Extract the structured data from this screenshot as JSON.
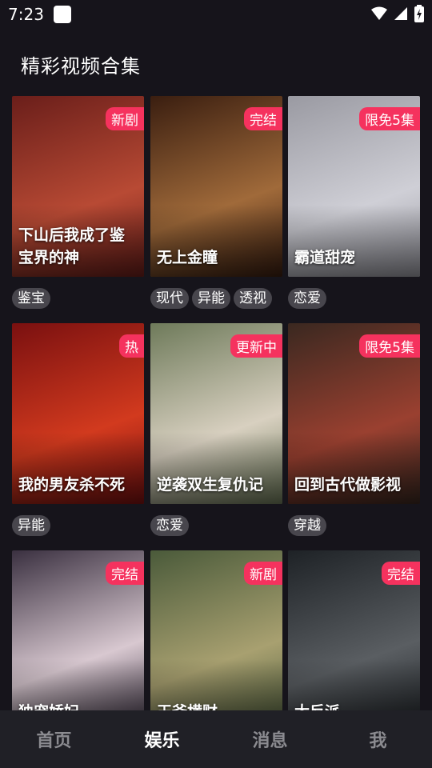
{
  "status_bar": {
    "time": "7:23"
  },
  "page_title": "精彩视频合集",
  "cards": [
    {
      "title": "下山后我成了鉴宝界的神",
      "badge": "新剧",
      "tags": [
        "鉴宝"
      ],
      "colors": [
        "#6a1e1a",
        "#b84a34"
      ]
    },
    {
      "title": "无上金瞳",
      "badge": "完结",
      "tags": [
        "现代",
        "异能",
        "透视"
      ],
      "colors": [
        "#3a1e10",
        "#a06a3a"
      ]
    },
    {
      "title": "霸道甜宠",
      "badge": "限免5集",
      "tags": [
        "恋爱"
      ],
      "colors": [
        "#9a9aa2",
        "#cfcfd6"
      ]
    },
    {
      "title": "我的男友杀不死",
      "badge": "热",
      "tags": [
        "异能"
      ],
      "colors": [
        "#7a1010",
        "#d23a1e"
      ]
    },
    {
      "title": "逆袭双生复仇记",
      "badge": "更新中",
      "tags": [
        "恋爱"
      ],
      "colors": [
        "#6e7a5a",
        "#d8d0c0"
      ]
    },
    {
      "title": "回到古代做影视",
      "badge": "限免5集",
      "tags": [
        "穿越"
      ],
      "colors": [
        "#3a2820",
        "#9a4030"
      ]
    },
    {
      "title": "独宠娇妃",
      "badge": "完结",
      "tags": [],
      "colors": [
        "#3a3040",
        "#d8c8d0"
      ]
    },
    {
      "title": "王爷横财",
      "badge": "新剧",
      "tags": [],
      "colors": [
        "#4a5a3a",
        "#a8a070"
      ]
    },
    {
      "title": "大反派",
      "badge": "完结",
      "tags": [],
      "colors": [
        "#1e2226",
        "#5a5e62"
      ]
    }
  ],
  "bottom_nav": [
    {
      "label": "首页",
      "active": false
    },
    {
      "label": "娱乐",
      "active": true
    },
    {
      "label": "消息",
      "active": false
    },
    {
      "label": "我",
      "active": false
    }
  ]
}
